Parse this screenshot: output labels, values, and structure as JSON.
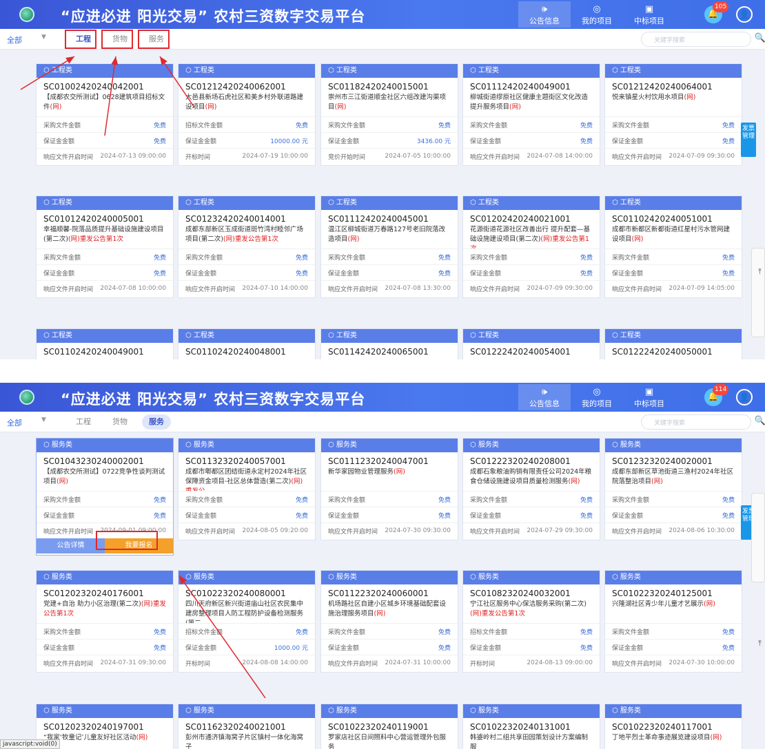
{
  "header": {
    "title_quoted": "“应进必进 阳光交易”",
    "title_rest": "农村三资数字交易平台",
    "nav": [
      "公告信息",
      "我的项目",
      "中标项目"
    ],
    "user_label": "用户"
  },
  "screens": [
    {
      "badge": "105",
      "filter_all": "全部",
      "tabs": [
        "工程",
        "货物",
        "服务"
      ],
      "active_tab": "工程",
      "search_placeholder": "关键字搜索",
      "side_panel": "发票 管理",
      "cards": [
        {
          "cat": "工程类",
          "code": "SC01002420240042001",
          "name": "【成都农交所测试】0628建筑项目招标文件",
          "web": "(网)",
          "rows": [
            [
              "采购文件金额",
              "免费"
            ],
            [
              "保证金金额",
              "免费"
            ],
            [
              "响应文件开启时间",
              "2024-07-13 09:00:00"
            ]
          ]
        },
        {
          "cat": "工程类",
          "code": "SC01212420240062001",
          "name": "大邑县新场石虎社区和美乡村外联道路建设项目",
          "web": "(网)",
          "rows": [
            [
              "招标文件金额",
              "免费"
            ],
            [
              "保证金金额",
              "10000.00 元"
            ],
            [
              "开标时间",
              "2024-07-19 10:00:00"
            ]
          ]
        },
        {
          "cat": "工程类",
          "code": "SC01182420240015001",
          "name": "崇州市三江街道顺金社区六组改建沟渠项目",
          "web": "(网)",
          "rows": [
            [
              "采购文件金额",
              "免费"
            ],
            [
              "保证金金额",
              "3436.00 元"
            ],
            [
              "竞价开始时间",
              "2024-07-05 10:00:00"
            ]
          ]
        },
        {
          "cat": "工程类",
          "code": "SC01112420240049001",
          "name": "柳城街道缪原社区健康主题街区文化改造提升服务项目",
          "web": "(网)",
          "rows": [
            [
              "采购文件金额",
              "免费"
            ],
            [
              "保证金金额",
              "免费"
            ],
            [
              "响应文件开启时间",
              "2024-07-08 14:00:00"
            ]
          ]
        },
        {
          "cat": "工程类",
          "code": "SC01212420240064001",
          "name": "悦来镇星火村饮用水项目",
          "web": "(网)",
          "rows": [
            [
              "采购文件金额",
              "免费"
            ],
            [
              "保证金金额",
              "免费"
            ],
            [
              "响应文件开启时间",
              "2024-07-09 09:30:00"
            ]
          ]
        },
        {
          "cat": "工程类",
          "code": "SC01012420240005001",
          "name": "幸福顺馨-院落品质提升基础设施建设项目(第二次)",
          "web": "(网)重发公告第1次",
          "rows": [
            [
              "采购文件金额",
              "免费"
            ],
            [
              "保证金金额",
              "免费"
            ],
            [
              "响应文件开启时间",
              "2024-07-08 10:00:00"
            ]
          ]
        },
        {
          "cat": "工程类",
          "code": "SC01232420240014001",
          "name": "成都东部新区玉成街道斑竹湾村睦邻广场项目(第二次)",
          "web": "(网)重发公告第1次",
          "rows": [
            [
              "采购文件金额",
              "免费"
            ],
            [
              "保证金金额",
              "免费"
            ],
            [
              "响应文件开启时间",
              "2024-07-10 14:00:00"
            ]
          ]
        },
        {
          "cat": "工程类",
          "code": "SC01112420240045001",
          "name": "温江区柳城街道万春路127号老旧院落改造项目",
          "web": "(网)",
          "rows": [
            [
              "采购文件金额",
              "免费"
            ],
            [
              "保证金金额",
              "免费"
            ],
            [
              "响应文件开启时间",
              "2024-07-08 13:30:00"
            ]
          ]
        },
        {
          "cat": "工程类",
          "code": "SC01202420240021001",
          "name": "花源街道花源社区改善出行 提升配套—基础设施建设项目(第二次)",
          "web": "(网)重发公告第1次",
          "rows": [
            [
              "采购文件金额",
              "免费"
            ],
            [
              "保证金金额",
              "免费"
            ],
            [
              "响应文件开启时间",
              "2024-07-09 09:30:00"
            ]
          ]
        },
        {
          "cat": "工程类",
          "code": "SC01102420240051001",
          "name": "成都市新都区新都街道红星村污水管网建设项目",
          "web": "(网)",
          "rows": [
            [
              "采购文件金额",
              "免费"
            ],
            [
              "保证金金额",
              "免费"
            ],
            [
              "响应文件开启时间",
              "2024-07-09 14:05:00"
            ]
          ]
        },
        {
          "cat": "工程类",
          "code": "SC01102420240049001",
          "name": "",
          "web": "",
          "rows": []
        },
        {
          "cat": "工程类",
          "code": "SC01102420240048001",
          "name": "",
          "web": "",
          "rows": []
        },
        {
          "cat": "工程类",
          "code": "SC01142420240065001",
          "name": "",
          "web": "",
          "rows": []
        },
        {
          "cat": "工程类",
          "code": "SC01222420240054001",
          "name": "",
          "web": "",
          "rows": []
        },
        {
          "cat": "工程类",
          "code": "SC01222420240050001",
          "name": "",
          "web": "",
          "rows": []
        }
      ]
    },
    {
      "badge": "114",
      "filter_all": "全部",
      "tabs": [
        "工程",
        "货物",
        "服务"
      ],
      "active_tab": "服务",
      "search_placeholder": "关键字搜索",
      "side_panel": "发票 管理",
      "actions": [
        "公告详情",
        "我要报名"
      ],
      "cards": [
        {
          "cat": "服务类",
          "code": "SC01043230240002001",
          "name": "【成都农交所测试】0722竞争性谈判测试项目",
          "web": "(网)",
          "rows": [
            [
              "采购文件金额",
              "免费"
            ],
            [
              "保证金金额",
              "免费"
            ],
            [
              "响应文件开启时间",
              "2024-09-01 09:00:00"
            ]
          ]
        },
        {
          "cat": "服务类",
          "code": "SC01132320240057001",
          "name": "成都市郫都区团结街道永定村2024年社区保障资金项目-社区总体营造(第二次)",
          "web": "(网)重发公",
          "rows": [
            [
              "采购文件金额",
              "免费"
            ],
            [
              "保证金金额",
              "免费"
            ],
            [
              "响应文件开启时间",
              "2024-08-05 09:20:00"
            ]
          ]
        },
        {
          "cat": "服务类",
          "code": "SC01112320240047001",
          "name": "新华家园物业管理服务",
          "web": "(网)",
          "rows": [
            [
              "采购文件金额",
              "免费"
            ],
            [
              "保证金金额",
              "免费"
            ],
            [
              "响应文件开启时间",
              "2024-07-30 09:30:00"
            ]
          ]
        },
        {
          "cat": "服务类",
          "code": "SC01222320240208001",
          "name": "成都石象粮油购销有限责任公司2024年粮食仓储设施建设项目质量检测服务",
          "web": "(网)",
          "rows": [
            [
              "采购文件金额",
              "免费"
            ],
            [
              "保证金金额",
              "免费"
            ],
            [
              "响应文件开启时间",
              "2024-07-29 09:30:00"
            ]
          ]
        },
        {
          "cat": "服务类",
          "code": "SC01232320240020001",
          "name": "成都东部新区草池街道三渔村2024年社区院落整治项目",
          "web": "(网)",
          "rows": [
            [
              "采购文件金额",
              "免费"
            ],
            [
              "保证金金额",
              "免费"
            ],
            [
              "响应文件开启时间",
              "2024-08-06 10:30:00"
            ]
          ]
        },
        {
          "cat": "服务类",
          "code": "SC01202320240176001",
          "name": "党建+自治 助力小区治理(第二次)",
          "web": "(网)重发公告第1次",
          "rows": [
            [
              "采购文件金额",
              "免费"
            ],
            [
              "保证金金额",
              "免费"
            ],
            [
              "响应文件开启时间",
              "2024-07-31 09:30:00"
            ]
          ]
        },
        {
          "cat": "服务类",
          "code": "SC01022320240080001",
          "name": "四川天府新区新兴街道庙山社区农民集中建房整理项目人防工程防护设备检测服务(第二",
          "web": "",
          "rows": [
            [
              "招标文件金额",
              "免费"
            ],
            [
              "保证金金额",
              "1000.00 元"
            ],
            [
              "开标时间",
              "2024-08-08 14:00:00"
            ]
          ]
        },
        {
          "cat": "服务类",
          "code": "SC01122320240060001",
          "name": "机场路社区自建小区城乡环境基础配套设施治理服务项目",
          "web": "(网)",
          "rows": [
            [
              "采购文件金额",
              "免费"
            ],
            [
              "保证金金额",
              "免费"
            ],
            [
              "响应文件开启时间",
              "2024-07-31 10:00:00"
            ]
          ]
        },
        {
          "cat": "服务类",
          "code": "SC01082320240032001",
          "name": "宁江社区服务中心保洁服务采购(第二次)",
          "web": "(网)重发公告第1次",
          "rows": [
            [
              "招标文件金额",
              "免费"
            ],
            [
              "保证金金额",
              "免费"
            ],
            [
              "开标时间",
              "2024-08-13 09:00:00"
            ]
          ]
        },
        {
          "cat": "服务类",
          "code": "SC01022320240125001",
          "name": "兴隆湖社区青少年儿童才艺展示",
          "web": "(网)",
          "rows": [
            [
              "采购文件金额",
              "免费"
            ],
            [
              "保证金金额",
              "免费"
            ],
            [
              "响应文件开启时间",
              "2024-07-30 10:00:00"
            ]
          ]
        },
        {
          "cat": "服务类",
          "code": "SC01202320240197001",
          "name": "“我家‘牧童记’儿童友好社区活动",
          "web": "(网)",
          "rows": []
        },
        {
          "cat": "服务类",
          "code": "SC01162320240021001",
          "name": "彭州市通济镇海窝子片区镇村一体化海窝子",
          "web": "",
          "rows": []
        },
        {
          "cat": "服务类",
          "code": "SC01022320240119001",
          "name": "罗家店社区日间照料中心营运管理外包服务",
          "web": "",
          "rows": []
        },
        {
          "cat": "服务类",
          "code": "SC01022320240131001",
          "name": "韩婆岭村二组共享田园策划设计方案编制服",
          "web": "",
          "rows": []
        },
        {
          "cat": "服务类",
          "code": "SC01022320240117001",
          "name": "丁地平烈士革命事迹展览建设项目",
          "web": "(网)",
          "rows": []
        }
      ],
      "status_text": "javascript:void(0)"
    }
  ],
  "colors": {
    "header": "#4a78ee",
    "card_header": "#5a7ee8",
    "accent": "#3a55c8",
    "highlight": "#e0282e",
    "orange": "#f5a029"
  }
}
